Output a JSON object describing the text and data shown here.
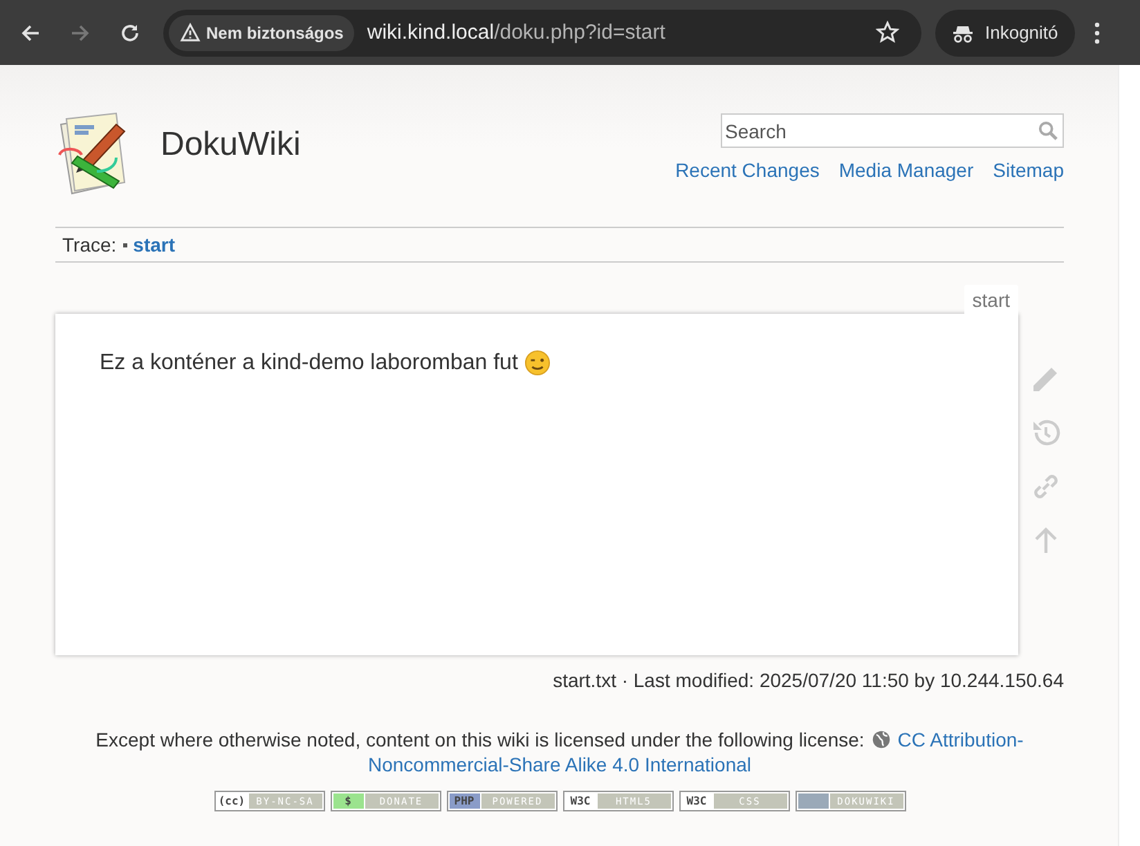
{
  "browser": {
    "security": "Nem biztonságos",
    "url_host": "wiki.kind.local",
    "url_path": "/doku.php?id=start",
    "profile": "Inkognitó"
  },
  "site": {
    "title": "DokuWiki",
    "search": {
      "placeholder": "Search"
    },
    "links": [
      "Recent Changes",
      "Media Manager",
      "Sitemap"
    ]
  },
  "trace": {
    "label": "Trace:",
    "items": [
      "start"
    ]
  },
  "page": {
    "tab": "start",
    "text": "Ez a konténer a kind-demo laboromban fut"
  },
  "docinfo": "start.txt · Last modified: 2025/07/20 11:50 by 10.244.150.64",
  "license": {
    "text": "Except where otherwise noted, content on this wiki is licensed under the following license:",
    "link_lines": [
      "CC Attribution-",
      "Noncommercial-Share Alike 4.0 International"
    ]
  },
  "badges": [
    {
      "left": "(cc)",
      "right": "BY-NC-SA",
      "color": "#ffffff"
    },
    {
      "left": "$",
      "right": "DONATE",
      "color": "#9be38e"
    },
    {
      "left": "PHP",
      "right": "POWERED",
      "color": "#8a9cc8"
    },
    {
      "left": "W3C",
      "right": "HTML5",
      "color": "#ffffff"
    },
    {
      "left": "W3C",
      "right": "CSS",
      "color": "#ffffff"
    },
    {
      "right": "DOKUWIKI",
      "color": "#9aa9b8"
    }
  ]
}
